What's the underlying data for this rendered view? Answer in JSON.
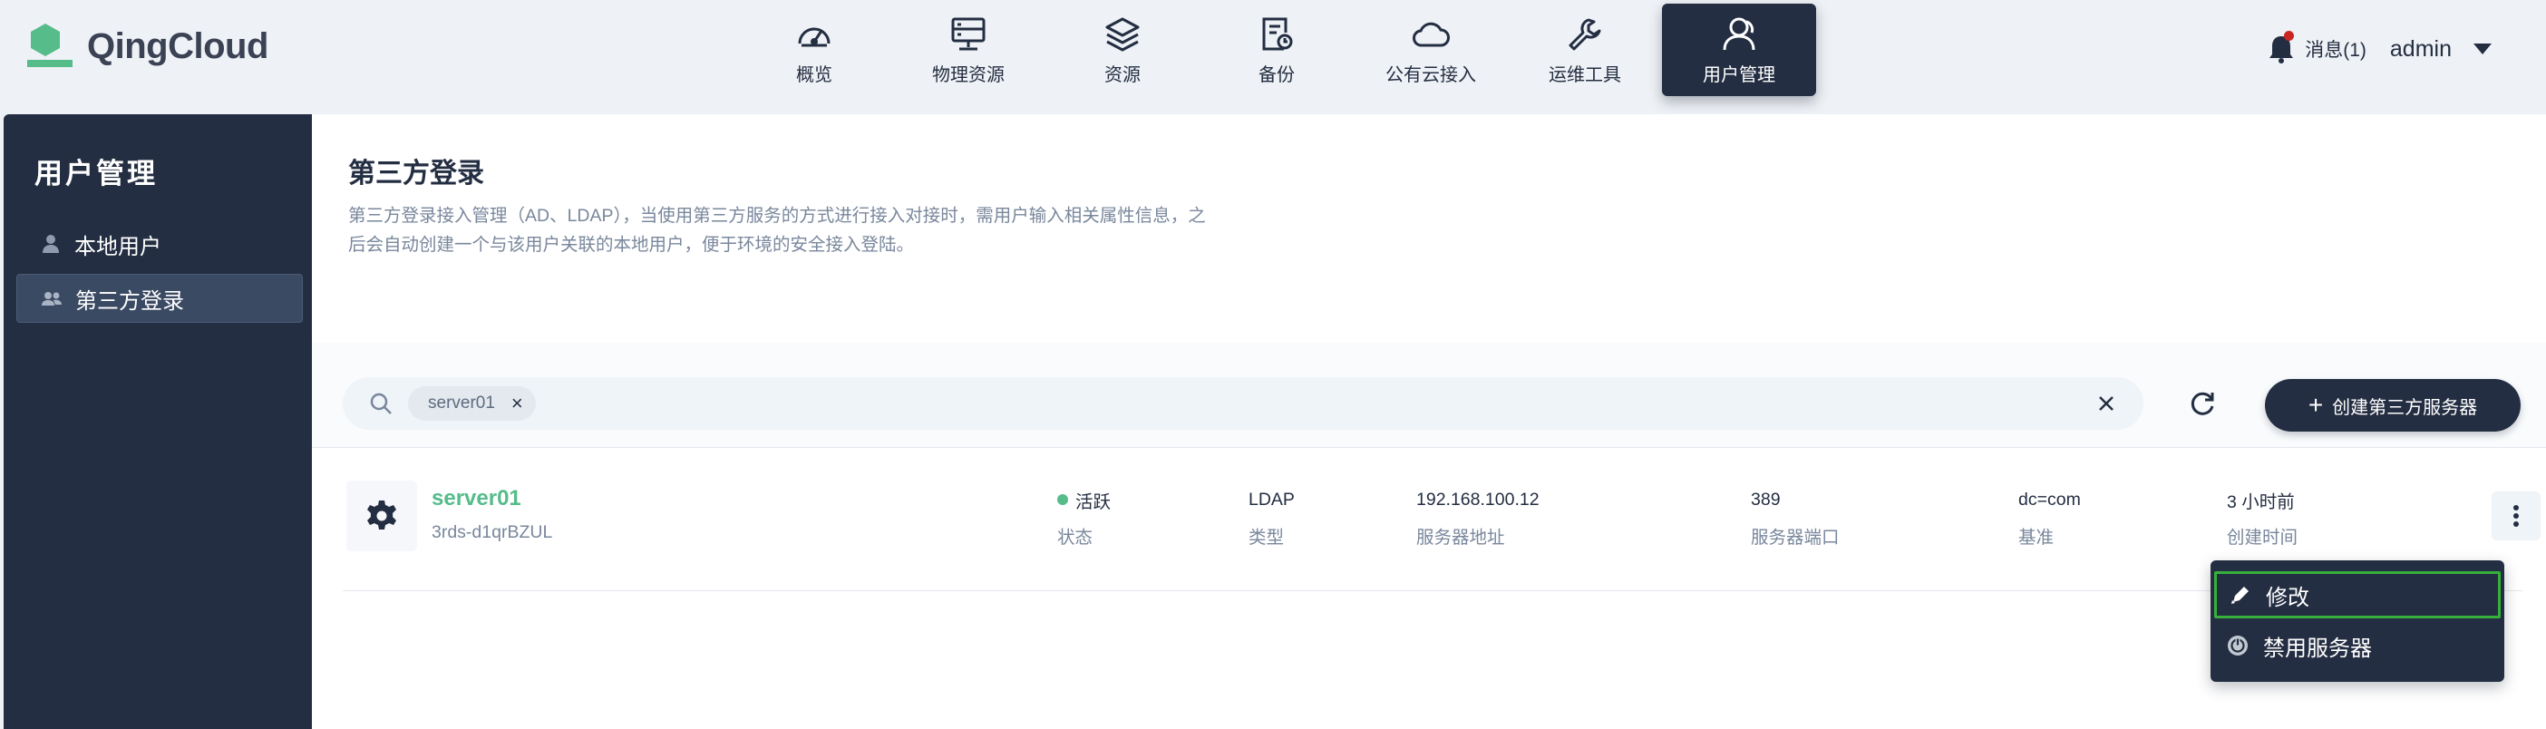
{
  "app": {
    "logo_text": "QingCloud"
  },
  "nav": [
    {
      "label": "概览",
      "icon": "dashboard-icon"
    },
    {
      "label": "物理资源",
      "icon": "server-icon"
    },
    {
      "label": "资源",
      "icon": "layers-icon"
    },
    {
      "label": "备份",
      "icon": "backup-icon"
    },
    {
      "label": "公有云接入",
      "icon": "cloud-icon"
    },
    {
      "label": "运维工具",
      "icon": "wrench-icon"
    },
    {
      "label": "用户管理",
      "icon": "users-icon",
      "active": true
    }
  ],
  "topright": {
    "messages": "消息(1)",
    "user": "admin"
  },
  "sidebar": {
    "title": "用户管理",
    "items": [
      {
        "label": "本地用户",
        "icon": "user-icon"
      },
      {
        "label": "第三方登录",
        "icon": "team-icon",
        "active": true
      }
    ]
  },
  "page": {
    "title": "第三方登录",
    "description": "第三方登录接入管理（AD、LDAP），当使用第三方服务的方式进行接入对接时，需用户输入相关属性信息，之后会自动创建一个与该用户关联的本地用户，便于环境的安全接入登陆。"
  },
  "toolbar": {
    "filter_tag": "server01",
    "create_label": "创建第三方服务器"
  },
  "servers": [
    {
      "name": "server01",
      "id": "3rds-d1qrBZUL",
      "status": "活跃",
      "status_label": "状态",
      "type": "LDAP",
      "type_label": "类型",
      "address": "192.168.100.12",
      "address_label": "服务器地址",
      "port": "389",
      "port_label": "服务器端口",
      "base": "dc=com",
      "base_label": "基准",
      "created": "3 小时前",
      "created_label": "创建时间"
    }
  ],
  "dropdown": [
    {
      "label": "修改",
      "icon": "edit-icon"
    },
    {
      "label": "禁用服务器",
      "icon": "power-icon"
    }
  ],
  "colors": {
    "accent": "#55bc8a",
    "dark": "#242e42",
    "focus_border": "#35b03a"
  }
}
